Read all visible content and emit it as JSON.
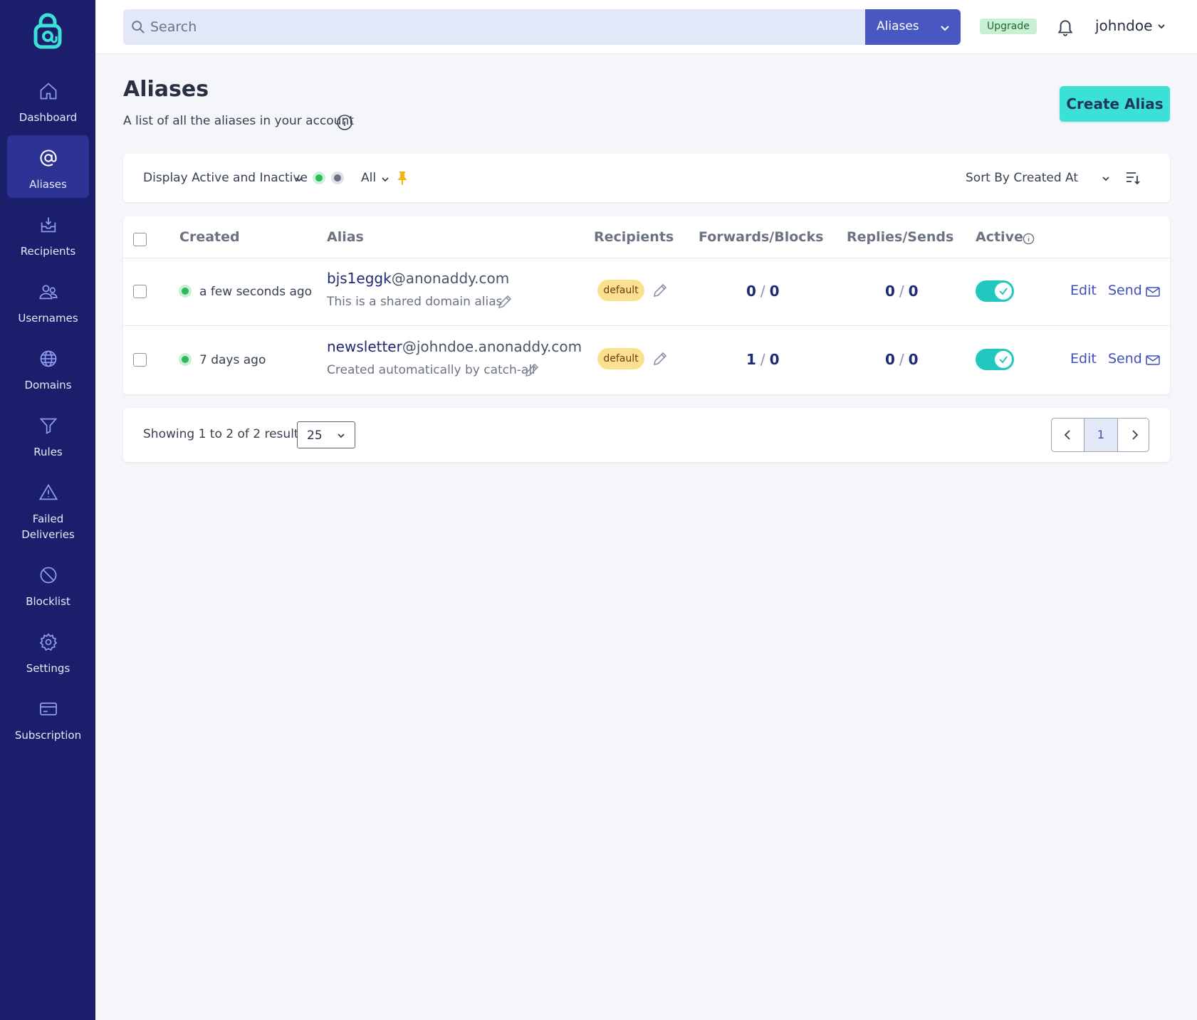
{
  "colors": {
    "sidebar_bg": "#1b1f6b",
    "sidebar_active": "#2c3394",
    "accent_teal": "#3be1d6",
    "scope_button": "#4957c2",
    "toggle_on": "#20c8c0",
    "badge_default": "#fbe08f",
    "status_green": "#2fb85a"
  },
  "sidebar": {
    "logo_icon": "anonaddy-lock-logo",
    "items": [
      {
        "label": "Dashboard",
        "icon": "home-icon",
        "active": false
      },
      {
        "label": "Aliases",
        "icon": "at-sign-icon",
        "active": true
      },
      {
        "label": "Recipients",
        "icon": "inbox-download-icon",
        "active": false
      },
      {
        "label": "Usernames",
        "icon": "users-icon",
        "active": false
      },
      {
        "label": "Domains",
        "icon": "globe-icon",
        "active": false
      },
      {
        "label": "Rules",
        "icon": "filter-icon",
        "active": false
      },
      {
        "label": "Failed\nDeliveries",
        "icon": "warning-triangle-icon",
        "active": false
      },
      {
        "label": "Blocklist",
        "icon": "block-icon",
        "active": false
      },
      {
        "label": "Settings",
        "icon": "gear-icon",
        "active": false
      },
      {
        "label": "Subscription",
        "icon": "credit-card-icon",
        "active": false
      }
    ]
  },
  "topbar": {
    "search_placeholder": "Search",
    "search_value": "",
    "scope": "Aliases",
    "upgrade": "Upgrade",
    "username": "johndoe"
  },
  "header": {
    "title": "Aliases",
    "subtitle": "A list of all the aliases in your account",
    "create_button": "Create Alias"
  },
  "filters": {
    "display": "Display Active and Inactive",
    "shared": "All",
    "sort": "Sort By Created At"
  },
  "table": {
    "columns": [
      "Created",
      "Alias",
      "Recipients",
      "Forwards/Blocks",
      "Replies/Sends",
      "Active"
    ],
    "rows": [
      {
        "created": "a few seconds ago",
        "alias_local": "bjs1eggk",
        "alias_domain": "@anonaddy.com",
        "description": "This is a shared domain alias",
        "recipient": "default",
        "forwards": "0",
        "blocks": "0",
        "replies": "0",
        "sends": "0",
        "active": true,
        "edit": "Edit",
        "send": "Send"
      },
      {
        "created": "7 days ago",
        "alias_local": "newsletter",
        "alias_domain": "@johndoe.anonaddy.com",
        "description": "Created automatically by catch-all",
        "recipient": "default",
        "forwards": "1",
        "blocks": "0",
        "replies": "0",
        "sends": "0",
        "active": true,
        "edit": "Edit",
        "send": "Send"
      }
    ]
  },
  "pagination": {
    "summary": "Showing 1 to 2 of 2 results",
    "per_page": "25",
    "current_page": "1"
  }
}
